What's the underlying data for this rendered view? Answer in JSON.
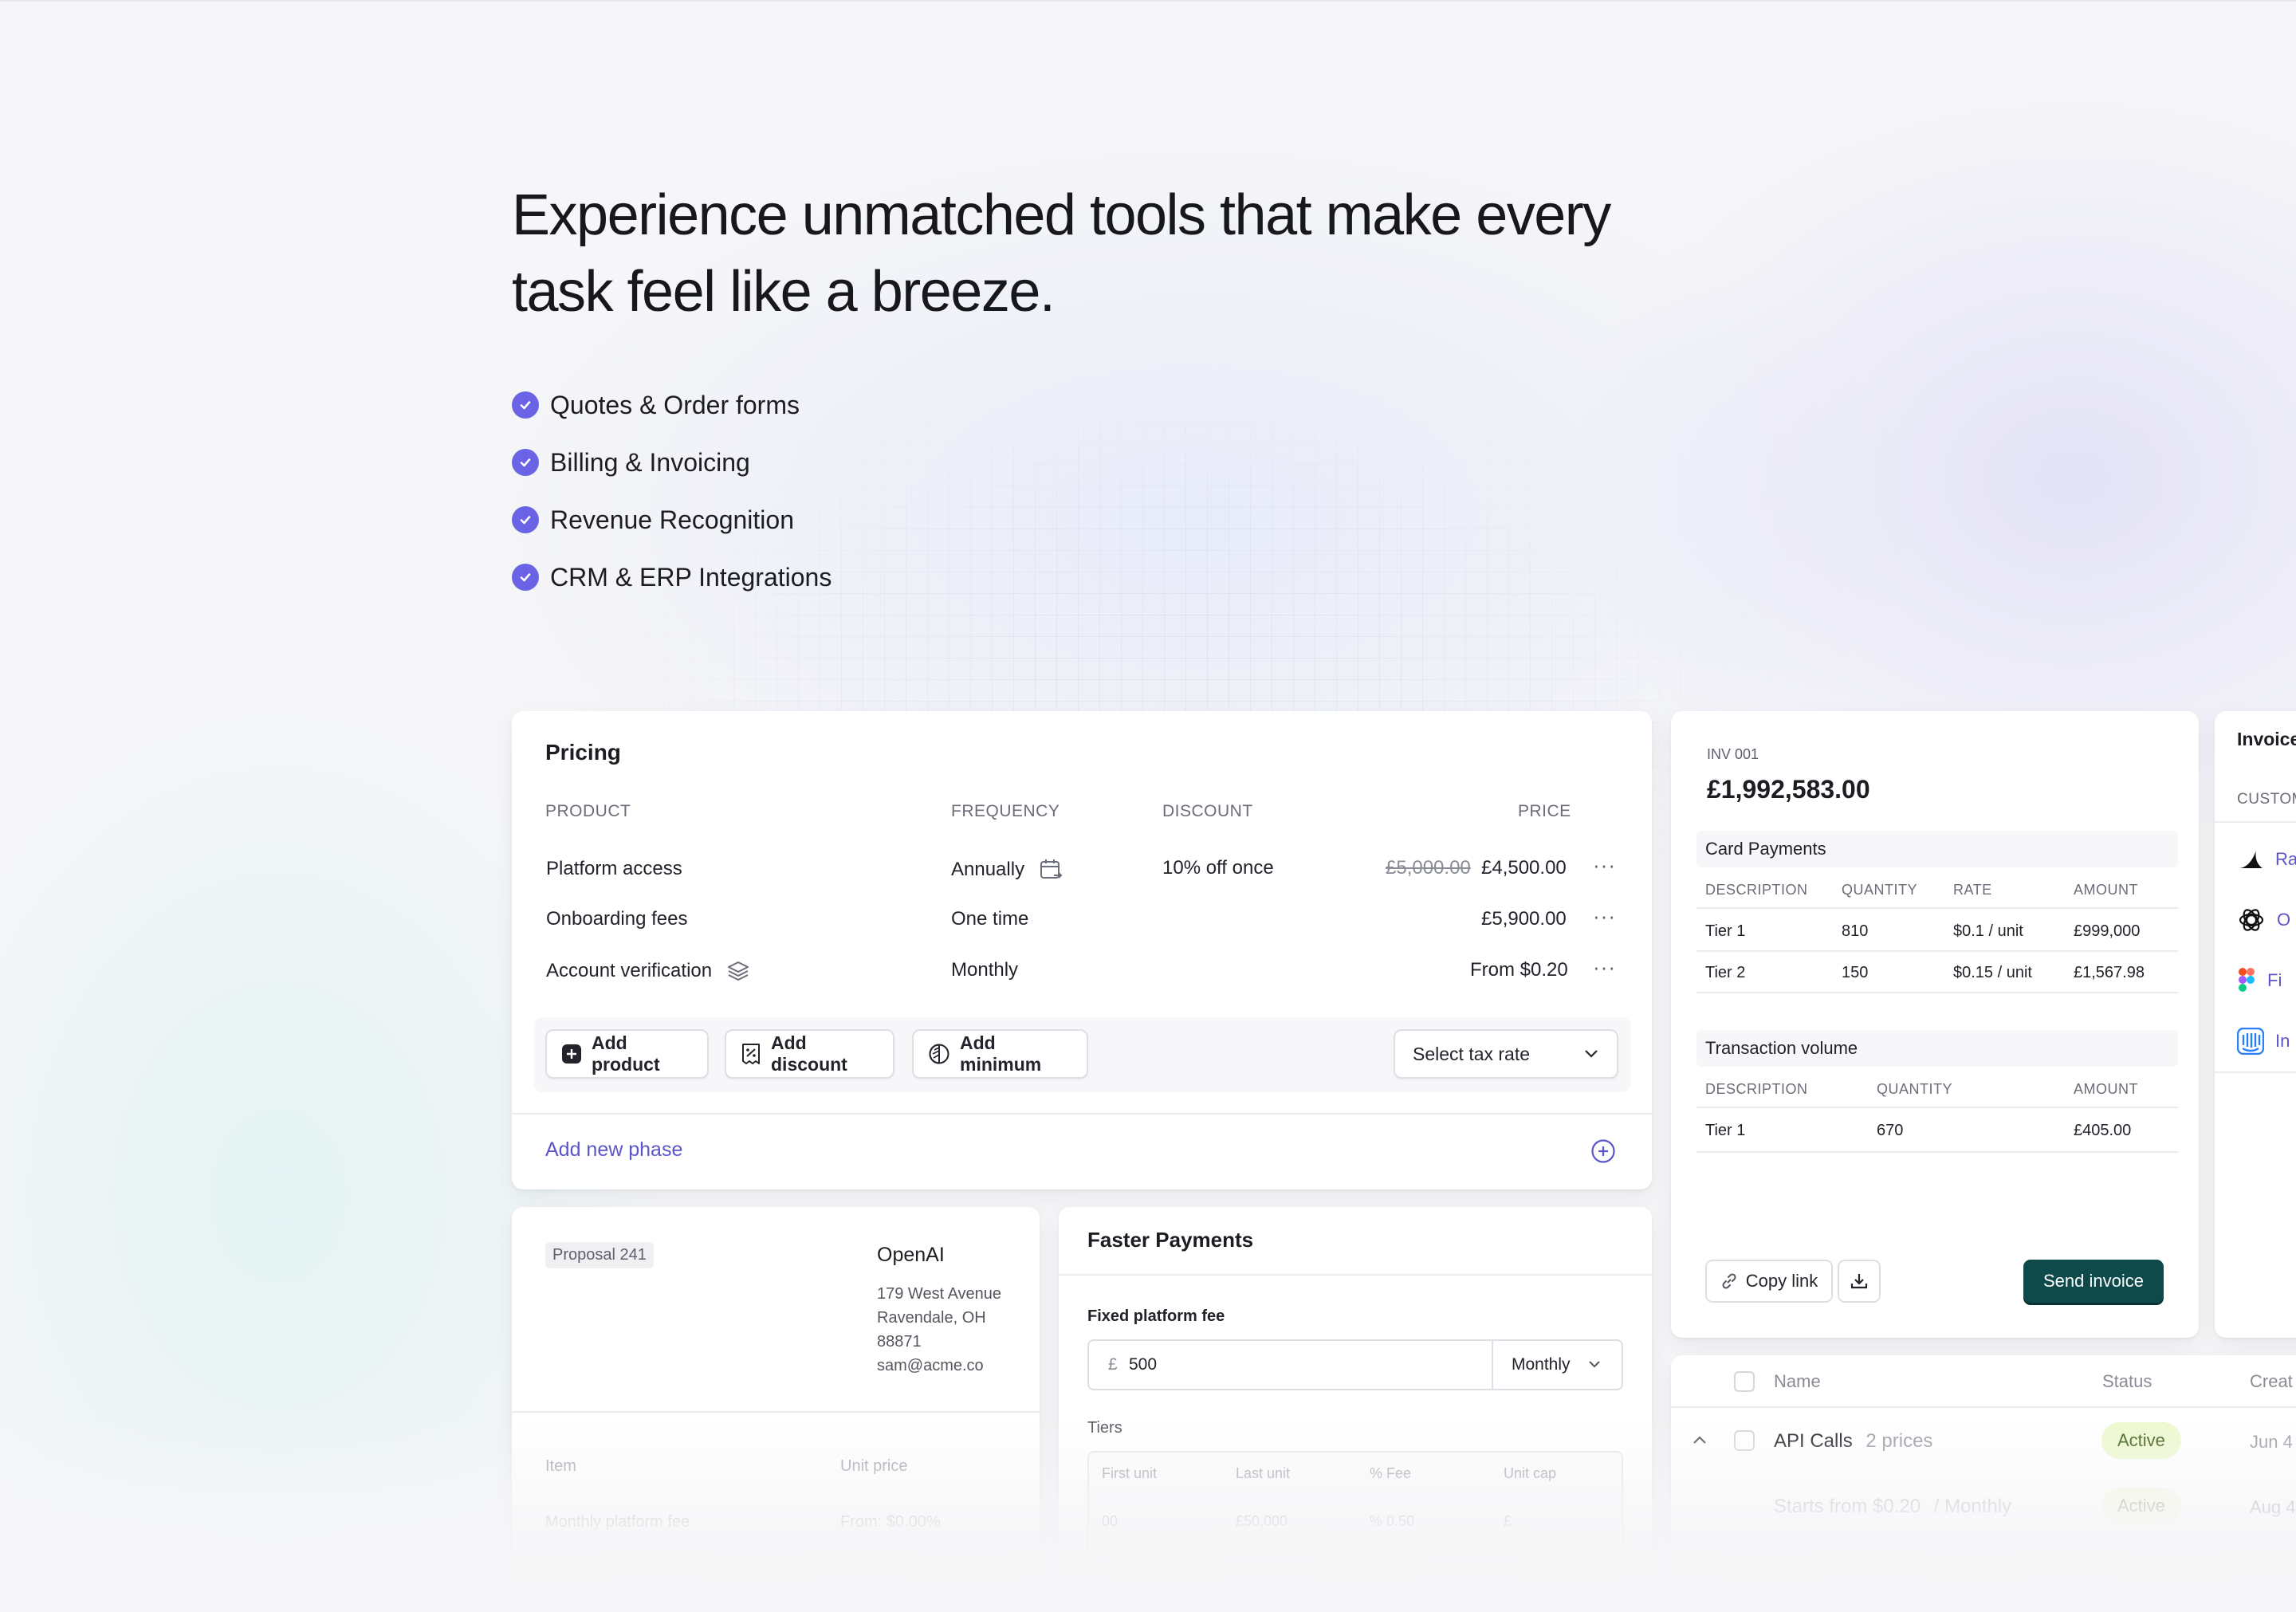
{
  "hero": {
    "title_line1": "Experience unmatched tools that make every",
    "title_line2": "task feel like a breeze.",
    "features": [
      "Quotes & Order forms",
      "Billing & Invoicing",
      "Revenue Recognition",
      "CRM & ERP Integrations"
    ]
  },
  "pricing": {
    "title": "Pricing",
    "columns": {
      "product": "PRODUCT",
      "frequency": "FREQUENCY",
      "discount": "DISCOUNT",
      "price": "PRICE"
    },
    "rows": [
      {
        "product": "Platform access",
        "frequency": "Annually",
        "discount": "10% off once",
        "old_price": "£5,000.00",
        "price": "£4,500.00"
      },
      {
        "product": "Onboarding fees",
        "frequency": "One time",
        "discount": "",
        "old_price": "",
        "price": "£5,900.00"
      },
      {
        "product": "Account verification",
        "frequency": "Monthly",
        "discount": "",
        "old_price": "",
        "price": "From $0.20"
      }
    ],
    "more_label": "···",
    "add_product": "Add product",
    "add_discount": "Add discount",
    "add_minimum": "Add minimum",
    "tax_select": "Select tax rate",
    "add_phase": "Add new phase"
  },
  "invoice": {
    "number": "INV 001",
    "total": "£1,992,583.00",
    "card_payments": {
      "title": "Card Payments",
      "headers": [
        "DESCRIPTION",
        "QUANTITY",
        "RATE",
        "AMOUNT"
      ],
      "rows": [
        [
          "Tier 1",
          "810",
          "$0.1 / unit",
          "£999,000"
        ],
        [
          "Tier 2",
          "150",
          "$0.15 / unit",
          "£1,567.98"
        ]
      ]
    },
    "transaction_volume": {
      "title": "Transaction volume",
      "headers": [
        "DESCRIPTION",
        "QUANTITY",
        "AMOUNT"
      ],
      "rows": [
        [
          "Tier 1",
          "670",
          "£405.00"
        ]
      ]
    },
    "copy_link": "Copy link",
    "send": "Send invoice"
  },
  "invoices_list": {
    "title": "Invoices",
    "header": "CUSTOMER",
    "rows": [
      {
        "icon": "ramp-logo",
        "text": "Ra"
      },
      {
        "icon": "openai-logo",
        "text": "O"
      },
      {
        "icon": "figma-logo",
        "text": "Fi"
      },
      {
        "icon": "intercom-logo",
        "text": "In"
      }
    ]
  },
  "proposal": {
    "tag": "Proposal 241",
    "company": "OpenAI",
    "address": [
      "179 West Avenue",
      "Ravendale, OH",
      "88871",
      "sam@acme.co"
    ],
    "col_item": "Item",
    "col_unit_price": "Unit price",
    "row_item": "Monthly platform fee",
    "row_price": "From: $0.00%"
  },
  "faster": {
    "title": "Faster Payments",
    "fixed_label": "Fixed platform fee",
    "currency": "£",
    "fee_value": "500",
    "period": "Monthly",
    "tiers_label": "Tiers",
    "tier_headers": [
      "First unit",
      "Last unit",
      "% Fee",
      "Unit cap"
    ],
    "tier_row": [
      "00",
      "£50,000",
      "% 0.50",
      "£"
    ]
  },
  "products": {
    "headers": {
      "name": "Name",
      "status": "Status",
      "created": "Creat"
    },
    "rows": [
      {
        "name": "API Calls",
        "meta": "2 prices",
        "status": "Active",
        "created": "Jun 4"
      },
      {
        "name": "Starts from $0.20",
        "meta": "/ Monthly",
        "status": "Active",
        "created": "Aug 4"
      }
    ]
  },
  "colors": {
    "accent": "#6b63e6",
    "send_button": "#0f4a4a",
    "link": "#5b55c9",
    "active_pill": "#eef8cf"
  }
}
